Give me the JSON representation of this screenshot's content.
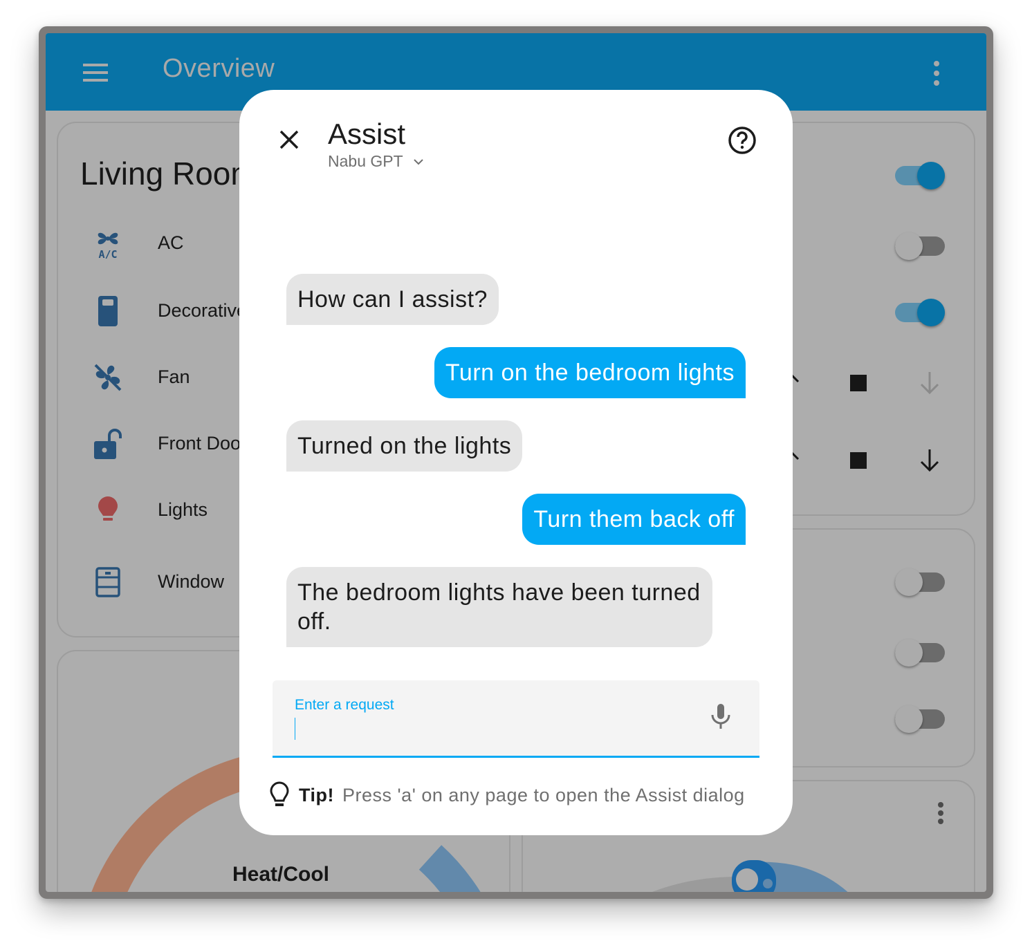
{
  "app": {
    "title": "Overview",
    "header_color": "#0873a6"
  },
  "living_room": {
    "title": "Living Room",
    "entities": [
      {
        "name": "AC",
        "icon": "air-conditioner-icon",
        "color": "#27527a"
      },
      {
        "name": "Decorative",
        "icon": "outlet-icon",
        "color": "#27527a"
      },
      {
        "name": "Fan",
        "icon": "fan-off-icon",
        "color": "#27527a"
      },
      {
        "name": "Front Door",
        "icon": "lock-open-icon",
        "color": "#27527a"
      },
      {
        "name": "Lights",
        "icon": "lightbulb-icon",
        "color": "#a34848"
      },
      {
        "name": "Window",
        "icon": "window-closed-icon",
        "color": "#27527a"
      }
    ]
  },
  "right_card": {
    "toggles": [
      {
        "state": "on"
      },
      {
        "state": "off"
      },
      {
        "state": "on"
      }
    ],
    "cover_rows": [
      {
        "up": "enabled",
        "stop": "enabled",
        "down": "disabled"
      },
      {
        "up": "enabled",
        "stop": "enabled",
        "down": "enabled"
      }
    ]
  },
  "second_right_card": {
    "toggles": [
      {
        "state": "off"
      },
      {
        "state": "off"
      },
      {
        "state": "off"
      }
    ]
  },
  "thermostat": {
    "mode_label": "Heat/Cool",
    "heat_color": "#b07c64",
    "cool_color": "#6289ab"
  },
  "assist_dialog": {
    "title": "Assist",
    "pipeline": "Nabu GPT",
    "messages": [
      {
        "from": "assistant",
        "text": "How can I assist?"
      },
      {
        "from": "user",
        "text": "Turn on the bedroom lights"
      },
      {
        "from": "assistant",
        "text": "Turned on the lights"
      },
      {
        "from": "user",
        "text": "Turn them back off"
      },
      {
        "from": "assistant",
        "text": "The bedroom lights have been turned off."
      }
    ],
    "input": {
      "label": "Enter a request",
      "value": ""
    },
    "tip": {
      "label": "Tip!",
      "text": "Press 'a' on any page to open the Assist dialog"
    },
    "accent_color": "#03a9f4"
  }
}
